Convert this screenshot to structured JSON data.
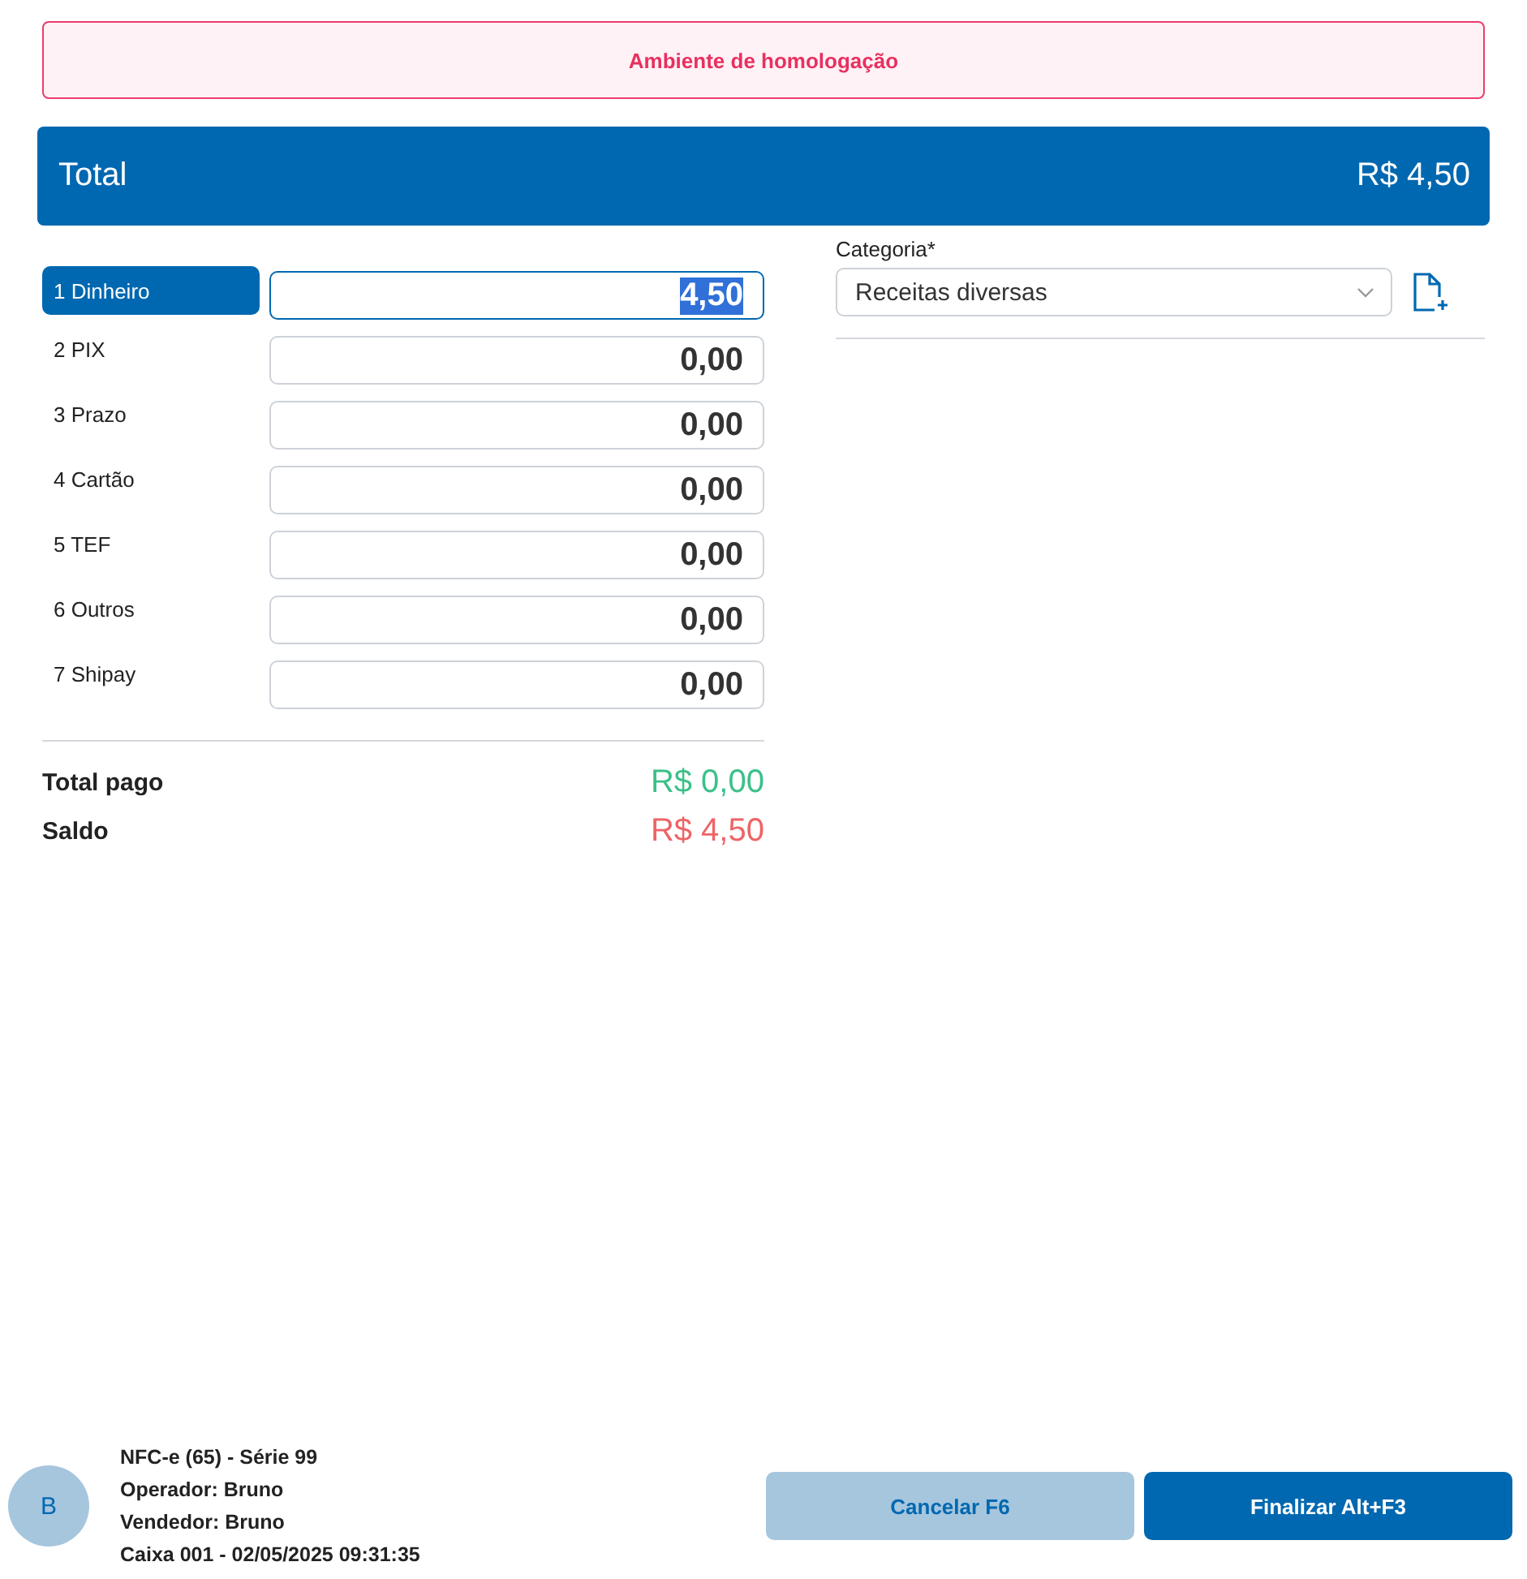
{
  "banner": {
    "text": "Ambiente de homologação"
  },
  "total": {
    "label": "Total",
    "value": "R$ 4,50"
  },
  "payment_methods": [
    {
      "label": "1 Dinheiro",
      "amount": "4,50",
      "selected": true
    },
    {
      "label": "2 PIX",
      "amount": "0,00",
      "selected": false
    },
    {
      "label": "3 Prazo",
      "amount": "0,00",
      "selected": false
    },
    {
      "label": "4 Cartão",
      "amount": "0,00",
      "selected": false
    },
    {
      "label": "5 TEF",
      "amount": "0,00",
      "selected": false
    },
    {
      "label": "6 Outros",
      "amount": "0,00",
      "selected": false
    },
    {
      "label": "7 Shipay",
      "amount": "0,00",
      "selected": false
    }
  ],
  "summary": [
    {
      "label": "Total pago",
      "value": "R$ 0,00",
      "color": "#3cc08a"
    },
    {
      "label": "Saldo",
      "value": "R$ 4,50",
      "color": "#ee6466"
    }
  ],
  "category": {
    "label": "Categoria*",
    "value": "Receitas diversas"
  },
  "footer": {
    "avatar": "B",
    "info": [
      "NFC-e (65) - Série 99",
      "Operador: Bruno",
      "Vendedor: Bruno",
      "Caixa 001 - 02/05/2025 09:31:35"
    ],
    "buttons": [
      {
        "label": "Cancelar F6",
        "kind": "secondary"
      },
      {
        "label": "Finalizar Alt+F3",
        "kind": "primary"
      }
    ]
  }
}
